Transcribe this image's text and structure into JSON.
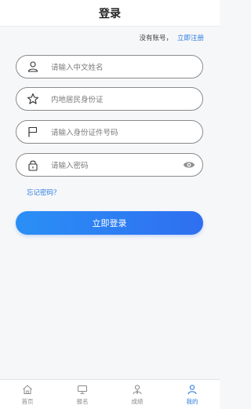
{
  "header": {
    "title": "登录"
  },
  "register": {
    "prompt": "没有账号，",
    "link": "立即注册"
  },
  "form": {
    "name_placeholder": "请输入中文姓名",
    "region_placeholder": "内地居民身份证",
    "id_placeholder": "请输入身份证件号码",
    "password_placeholder": "请输入密码"
  },
  "forgot_password": "忘记密码？",
  "login_button": "立即登录",
  "tabbar": {
    "items": [
      {
        "label": "首页",
        "icon": "home-icon"
      },
      {
        "label": "报名",
        "icon": "monitor-icon"
      },
      {
        "label": "成绩",
        "icon": "score-icon"
      },
      {
        "label": "我的",
        "icon": "user-icon"
      }
    ]
  },
  "colors": {
    "accent": "#2f7de1",
    "button_gradient_start": "#2a8ff5",
    "button_gradient_end": "#2f6ff0"
  }
}
